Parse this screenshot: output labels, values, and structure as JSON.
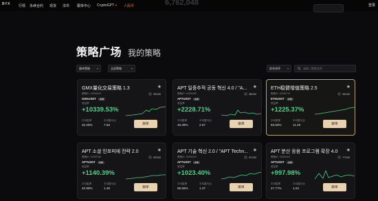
{
  "nav": {
    "logo": "BYX",
    "items": [
      {
        "label": "行情"
      },
      {
        "label": "永续合约"
      },
      {
        "label": "现货"
      },
      {
        "label": "法币"
      },
      {
        "label": "跟单中心"
      },
      {
        "label": "CryptoGPT",
        "suffix": "●"
      },
      {
        "label": "人民币",
        "accent": true
      }
    ],
    "right_label": "登录"
  },
  "header_ghost_number": "6,762,048",
  "tabs": {
    "active": "策略广场",
    "other": "我的策略"
  },
  "filters": {
    "filter1": "跟单策略",
    "filter2": "全部策略",
    "sort": "综合排序",
    "search_placeholder": "请输入策略名称"
  },
  "labels": {
    "return": "收益率",
    "win_rate": "平均胜率",
    "pnl_ratio": "平均盈亏比",
    "follow": "跟单"
  },
  "cards": [
    {
      "title": "GMX量化交易策略 1.3",
      "creator": "策略ID: 10006494",
      "users": "99/100",
      "pair": "GMXUSDT",
      "badge": "永续",
      "ret": "+10339.53%",
      "v1": "32.26%",
      "v2": "7.63",
      "highlight": false
    },
    {
      "title": "APT 일중추적 공동 혁신 4.0 / \"A...",
      "creator": "策略ID: 10006489",
      "users": "98/100",
      "pair": "APTUSDT",
      "badge": "永续",
      "ret": "+2228.71%",
      "v1": "48.39%",
      "v2": "2.57",
      "highlight": false
    },
    {
      "title": "ETH稳健增值策略 2.5",
      "creator": "策略ID: 10006713",
      "users": "46/100",
      "pair": "ETHUSDT",
      "badge": "永续",
      "ret": "+1225.37%",
      "v1": "63.50%",
      "v2": "11.26",
      "highlight": true
    },
    {
      "title": "APT 소셜 인포피에 전략 2.0",
      "creator": "策略ID: 10005766",
      "users": "92/100",
      "pair": "APTUSDT",
      "badge": "永续",
      "ret": "+1140.39%",
      "v1": "40.98%",
      "v2": "1.49",
      "highlight": false
    },
    {
      "title": "APT 기술 혁신 2.0 / \"APT Techn...",
      "creator": "策略ID: 10005322",
      "users": "97/100",
      "pair": "APTUSDT",
      "badge": "永续",
      "ret": "+1023.40%",
      "v1": "59.55%",
      "v2": "1.37",
      "highlight": false
    },
    {
      "title": "APT 분산 응용 프로그램 확장 4.0",
      "creator": "策略ID: 10005403",
      "users": "77/100",
      "pair": "APTUSDT",
      "badge": "永续",
      "ret": "+997.98%",
      "v1": "47.77%",
      "v2": "1.04",
      "highlight": false
    }
  ]
}
